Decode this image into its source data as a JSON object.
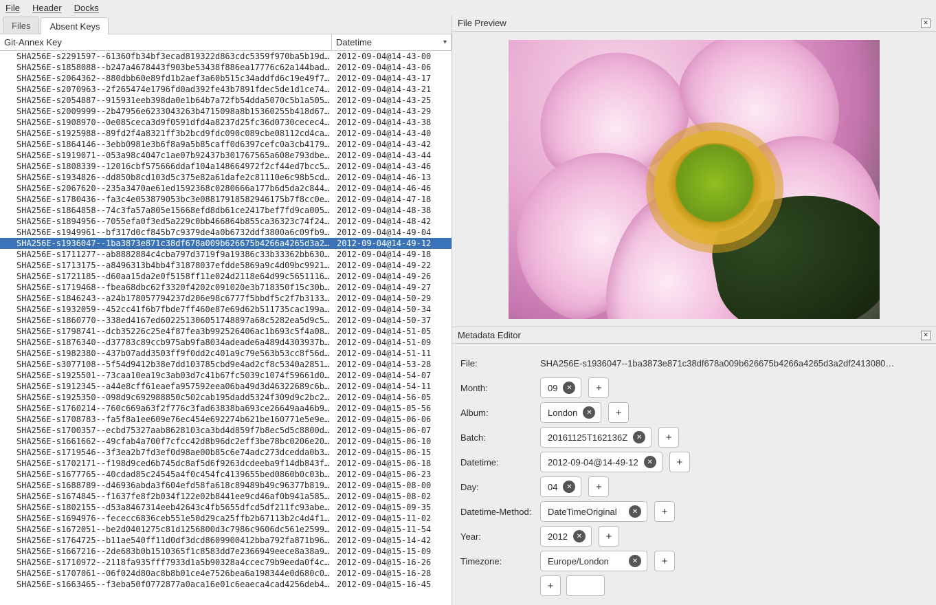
{
  "menubar": {
    "file": "File",
    "header": "Header",
    "docks": "Docks"
  },
  "tabs": {
    "files": "Files",
    "absent": "Absent Keys"
  },
  "columns": {
    "key": "Git-Annex Key",
    "datetime": "Datetime"
  },
  "selected_index": 17,
  "rows": [
    {
      "key": "SHA256E-s2291597--61360fb34bf3ecad819322d863cdc5359f970ba5b19d…",
      "dt": "2012-09-04@14-43-00"
    },
    {
      "key": "SHA256E-s1858088--b247a4678443f903be53438f886ea17776c62a144bad…",
      "dt": "2012-09-04@14-43-06"
    },
    {
      "key": "SHA256E-s2064362--880dbb60e89fd1b2aef3a60b515c34addfd6c19e49f7…",
      "dt": "2012-09-04@14-43-17"
    },
    {
      "key": "SHA256E-s2070963--2f265474e1796fd0ad392fe43b7891fdec5de1d1ce74…",
      "dt": "2012-09-04@14-43-21"
    },
    {
      "key": "SHA256E-s2054887--915931eeb398da0e1b64b7a72fb54dda5070c5b1a505…",
      "dt": "2012-09-04@14-43-25"
    },
    {
      "key": "SHA256E-s2009999--2b47956e6233043263b4715098a8b15360255b418d67…",
      "dt": "2012-09-04@14-43-29"
    },
    {
      "key": "SHA256E-s1908970--0e085ceca3d9f0591dfd4a8237d25fc36d0730cecec4…",
      "dt": "2012-09-04@14-43-38"
    },
    {
      "key": "SHA256E-s1925988--89fd2f4a8321ff3b2bcd9fdc090c089cbe08112cd4ca…",
      "dt": "2012-09-04@14-43-40"
    },
    {
      "key": "SHA256E-s1864146--3ebb0981e3b6f8a9a5b85caff0d6397cefc0a3cb4179…",
      "dt": "2012-09-04@14-43-42"
    },
    {
      "key": "SHA256E-s1919071--053a98c4047c1ae07b92437b301767565a608e793dbe…",
      "dt": "2012-09-04@14-43-44"
    },
    {
      "key": "SHA256E-s1808339--12016cbf575666ddaf104a148664972f2cf44ed7bcc5…",
      "dt": "2012-09-04@14-43-46"
    },
    {
      "key": "SHA256E-s1934826--dd850b8cd103d5c375e82a61dafe2c81110e6c98b5cd…",
      "dt": "2012-09-04@14-46-13"
    },
    {
      "key": "SHA256E-s2067620--235a3470ae61ed1592368c0280666a177b6d5da2c844…",
      "dt": "2012-09-04@14-46-46"
    },
    {
      "key": "SHA256E-s1780436--fa3c4e053879053bc3e08817918582946175b7f8cc0e…",
      "dt": "2012-09-04@14-47-18"
    },
    {
      "key": "SHA256E-s1864858--74c3fa57a805e15668efd8db61ce2417bef7fd9ca005…",
      "dt": "2012-09-04@14-48-38"
    },
    {
      "key": "SHA256E-s1894956--7055efa0f3ed5a229c0bb466864b855ca36323c74f24…",
      "dt": "2012-09-04@14-48-42"
    },
    {
      "key": "SHA256E-s1949961--bf317d0cf845b7c9379de4a0b6732ddf3800a6c09fb9…",
      "dt": "2012-09-04@14-49-04"
    },
    {
      "key": "SHA256E-s1936047--1ba3873e871c38df678a009b626675b4266a4265d3a2…",
      "dt": "2012-09-04@14-49-12"
    },
    {
      "key": "SHA256E-s1711277--ab8882884c4cba797d3719f9a19386c33b33362bb630…",
      "dt": "2012-09-04@14-49-18"
    },
    {
      "key": "SHA256E-s1713175--a8496313b4bb4f31878037efdde5869a9c4d09bc9921…",
      "dt": "2012-09-04@14-49-22"
    },
    {
      "key": "SHA256E-s1721185--d60aa15da2e0f5158ff11e024d2118e64d99c5651116…",
      "dt": "2012-09-04@14-49-26"
    },
    {
      "key": "SHA256E-s1719468--fbea68dbc62f3320f4202c091020e3b718350f15c30b…",
      "dt": "2012-09-04@14-49-27"
    },
    {
      "key": "SHA256E-s1846243--a24b178057794237d206e98c6777f5bbdf5c2f7b3133…",
      "dt": "2012-09-04@14-50-29"
    },
    {
      "key": "SHA256E-s1932059--452cc41f6b7fbde7ff460e87e69d62b511735cac199a…",
      "dt": "2012-09-04@14-50-34"
    },
    {
      "key": "SHA256E-s1860770--338ed4167ed602251306051748897a68c5282ea5d9c5…",
      "dt": "2012-09-04@14-50-37"
    },
    {
      "key": "SHA256E-s1798741--dcb35226c25e4f87fea3b992526406ac1b693c5f4a08…",
      "dt": "2012-09-04@14-51-05"
    },
    {
      "key": "SHA256E-s1876340--d37783c89ccb975ab9fa8034adeade6a489d4303937b…",
      "dt": "2012-09-04@14-51-09"
    },
    {
      "key": "SHA256E-s1982380--437b07add3503ff9f0dd2c401a9c79e563b53cc8f56d…",
      "dt": "2012-09-04@14-51-11"
    },
    {
      "key": "SHA256E-s3077108--5f54d9412b38e7dd103785cbd9e4ad2cf8c5340a2851…",
      "dt": "2012-09-04@14-53-28"
    },
    {
      "key": "SHA256E-s1925501--73caa10ea19c3ab03d7c41b67fc5039c1074f59661d08…",
      "dt": "2012-09-04@14-54-07"
    },
    {
      "key": "SHA256E-s1912345--a44e8cff61eaefa957592eea06ba49d3d46322689c6b…",
      "dt": "2012-09-04@14-54-11"
    },
    {
      "key": "SHA256E-s1925350--098d9c692988850c502cab195dadd5324f309d9c2bc2…",
      "dt": "2012-09-04@14-56-05"
    },
    {
      "key": "SHA256E-s1760214--760c669a63f2f776c3fad63838ba693ce26649aa46b9…",
      "dt": "2012-09-04@15-05-56"
    },
    {
      "key": "SHA256E-s1708783--fa5f8a1ee609e76ec454e692274b621be160771e5e9e…",
      "dt": "2012-09-04@15-06-06"
    },
    {
      "key": "SHA256E-s1700357--ecbd75327aab8628103ca3bd4d859f7b8ec5d5c8800d…",
      "dt": "2012-09-04@15-06-07"
    },
    {
      "key": "SHA256E-s1661662--49cfab4a700f7cfcc42d8b96dc2eff3be78bc0206e20…",
      "dt": "2012-09-04@15-06-10"
    },
    {
      "key": "SHA256E-s1719546--3f3ea2b7fd3ef0d98ae00b85c6e74adc273dcedda0b3…",
      "dt": "2012-09-04@15-06-15"
    },
    {
      "key": "SHA256E-s1702171--f198d9ced6b745dc8af5d6f9263dcdeeba9f14db843f…",
      "dt": "2012-09-04@15-06-18"
    },
    {
      "key": "SHA256E-s1677765--40cdad85c24545a4f0c454fc4139655bed0860b0c03b…",
      "dt": "2012-09-04@15-06-23"
    },
    {
      "key": "SHA256E-s1688789--d46936abda3f604efd58fa618c89489b49c96377b819…",
      "dt": "2012-09-04@15-08-00"
    },
    {
      "key": "SHA256E-s1674845--f1637fe8f2b034f122e02b8441ee9cd46af0b941a585…",
      "dt": "2012-09-04@15-08-02"
    },
    {
      "key": "SHA256E-s1802155--d53a8467314eeb42643c4fb5655dfcd5df211fc93abe…",
      "dt": "2012-09-04@15-09-35"
    },
    {
      "key": "SHA256E-s1694976--fececc6836ceb551e50d29ca25ffb2b67113b2c4d4f1…",
      "dt": "2012-09-04@15-11-02"
    },
    {
      "key": "SHA256E-s1672051--be2d0401275c81d1256800d3c7986c9606dc561e25997…",
      "dt": "2012-09-04@15-11-54"
    },
    {
      "key": "SHA256E-s1764725--b11ae540ff11d0df3dcd8609900412bba792fa871b96…",
      "dt": "2012-09-04@15-14-42"
    },
    {
      "key": "SHA256E-s1667216--2de683b0b1510365f1c8583dd7e2366949eece8a38a9…",
      "dt": "2012-09-04@15-15-09"
    },
    {
      "key": "SHA256E-s1710972--2118fa935fff7933d1a5b90328a4ccec79b9eeda0f4c…",
      "dt": "2012-09-04@15-16-26"
    },
    {
      "key": "SHA256E-s1707061--06f024d80ac8b8b01ce4e7526bea6a198344e0d680c0…",
      "dt": "2012-09-04@15-16-28"
    },
    {
      "key": "SHA256E-s1663465--f3eba50f0772877a0aca16e01c6eaeca4cad4256deb4…",
      "dt": "2012-09-04@15-16-45"
    }
  ],
  "preview": {
    "title": "File Preview"
  },
  "meta": {
    "title": "Metadata Editor",
    "file_label": "File:",
    "file_value": "SHA256E-s1936047--1ba3873e871c38df678a009b626675b4266a4265d3a2df2413080…",
    "fields": [
      {
        "label": "Month:",
        "value": "09"
      },
      {
        "label": "Album:",
        "value": "London"
      },
      {
        "label": "Batch:",
        "value": "20161125T162136Z"
      },
      {
        "label": "Datetime:",
        "value": "2012-09-04@14-49-12"
      },
      {
        "label": "Day:",
        "value": "04"
      },
      {
        "label": "Datetime-Method:",
        "value": "DateTimeOriginal"
      },
      {
        "label": "Year:",
        "value": "2012"
      },
      {
        "label": "Timezone:",
        "value": "Europe/London"
      }
    ],
    "plus": "+"
  }
}
